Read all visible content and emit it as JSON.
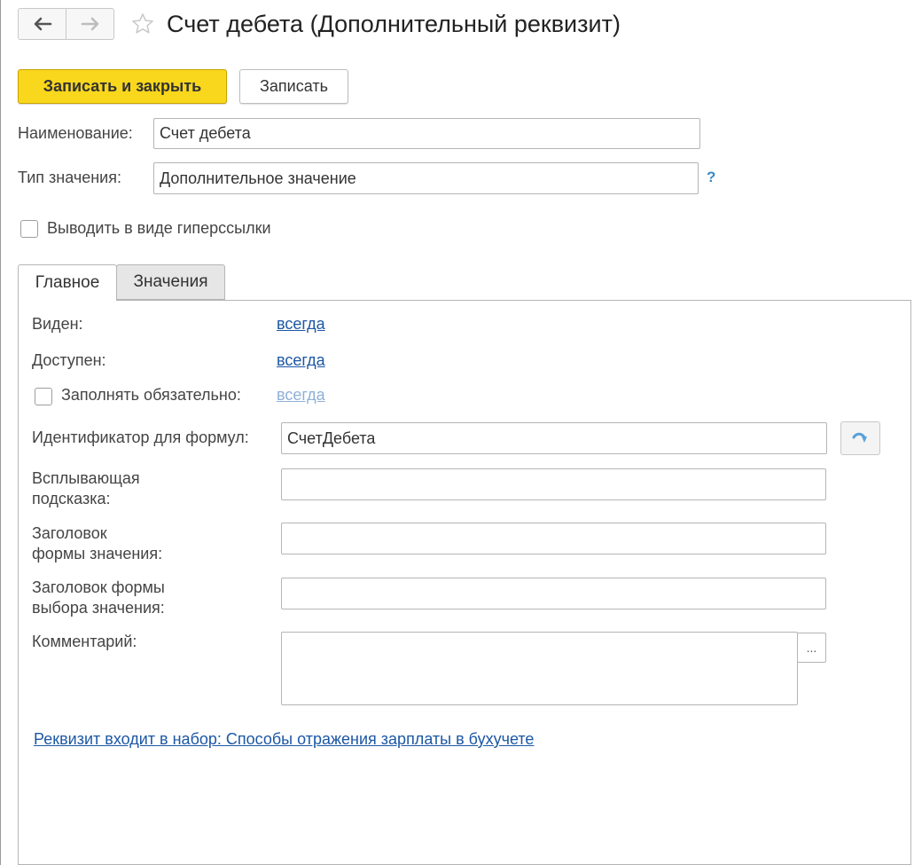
{
  "window": {
    "title": "Счет дебета (Дополнительный реквизит)"
  },
  "toolbar": {
    "save_close_label": "Записать и закрыть",
    "save_label": "Записать"
  },
  "form": {
    "name_label": "Наименование:",
    "name_value": "Счет дебета",
    "type_label": "Тип значения:",
    "type_value": "Дополнительное значение",
    "help_symbol": "?",
    "hyperlink_label": "Выводить в виде гиперссылки"
  },
  "tabs": [
    {
      "label": "Главное"
    },
    {
      "label": "Значения"
    }
  ],
  "main": {
    "visible_label": "Виден:",
    "visible_value": "всегда",
    "available_label": "Доступен:",
    "available_value": "всегда",
    "required_label": "Заполнять обязательно:",
    "required_value": "всегда",
    "formula_id_label": "Идентификатор для формул:",
    "formula_id_value": "СчетДебета",
    "tooltip_label_1": "Всплывающая",
    "tooltip_label_2": "подсказка:",
    "tooltip_value": "",
    "value_form_title_label_1": "Заголовок",
    "value_form_title_label_2": "формы значения:",
    "value_form_title_value": "",
    "select_form_title_label_1": "Заголовок формы",
    "select_form_title_label_2": "выбора значения:",
    "select_form_title_value": "",
    "comment_label": "Комментарий:",
    "comment_value": "",
    "comment_button": "...",
    "set_link": "Реквизит входит в набор: Способы отражения зарплаты в бухучете "
  },
  "colors": {
    "primary_button": "#f9d71c",
    "link": "#1c57a5",
    "link_disabled": "#8fb0d8",
    "help": "#3a8bc8"
  }
}
